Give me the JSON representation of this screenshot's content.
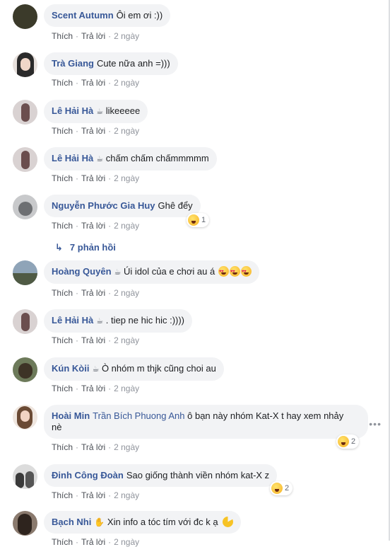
{
  "comments": [
    {
      "author": "Scent Autumn",
      "text": "Ôi em ơi :))",
      "like": "Thích",
      "reply": "Trả lời",
      "time": "2 ngày",
      "avatar_color": "#3b3a2a"
    },
    {
      "author": "Trà Giang",
      "text": "Cute nữa anh =)))",
      "like": "Thích",
      "reply": "Trả lời",
      "time": "2 ngày",
      "avatar_color": "#2a2a2a"
    },
    {
      "author": "Lê Hải Hà",
      "text": "likeeeee",
      "like": "Thích",
      "reply": "Trả lời",
      "time": "2 ngày",
      "avatar_color": "#b9a8a8"
    },
    {
      "author": "Lê Hải Hà",
      "text": "chấm chấm chấmmmmm",
      "like": "Thích",
      "reply": "Trả lời",
      "time": "2 ngày",
      "avatar_color": "#b9a8a8"
    },
    {
      "author": "Nguyễn Phước Gia Huy",
      "text": "Ghê đểy",
      "like": "Thích",
      "reply": "Trả lời",
      "time": "2 ngày",
      "reaction_count": "1",
      "avatar_color": "#7d7f82"
    },
    {
      "author": "Hoàng Quyên",
      "text": "Úi idol của e chơi au á",
      "like": "Thích",
      "reply": "Trả lời",
      "time": "2 ngày",
      "avatar_color": "#5d6e7f"
    },
    {
      "author": "Lê Hải Hà",
      "text": ". tiep ne hic hic :))))",
      "like": "Thích",
      "reply": "Trả lời",
      "time": "2 ngày",
      "avatar_color": "#b9a8a8"
    },
    {
      "author": "Kún Kòii",
      "text": "Ò nhóm m thjk cũng choi au",
      "like": "Thích",
      "reply": "Trả lời",
      "time": "2 ngày",
      "avatar_color": "#4d5a3f"
    },
    {
      "author": "Hoài Min",
      "mention": "Trần Bích Phuong Anh",
      "text": " ô bạn này nhóm Kat-X t hay xem nhảy nè",
      "like": "Thích",
      "reply": "Trả lời",
      "time": "2 ngày",
      "reaction_count": "2",
      "avatar_color": "#c6a58a"
    },
    {
      "author": "Đinh Công Đoàn",
      "text": "Sao giống thành viền nhóm kat-X z",
      "like": "Thích",
      "reply": "Trả lời",
      "time": "2 ngày",
      "reaction_count": "2",
      "avatar_color": "#8a8c8f"
    },
    {
      "author": "Bạch Nhi",
      "text": "Xin info a tóc tím với đc k ạ",
      "like": "Thích",
      "reply": "Trả lời",
      "time": "2 ngày",
      "avatar_color": "#5b4a40"
    }
  ],
  "replies_label": "7 phản hồi"
}
